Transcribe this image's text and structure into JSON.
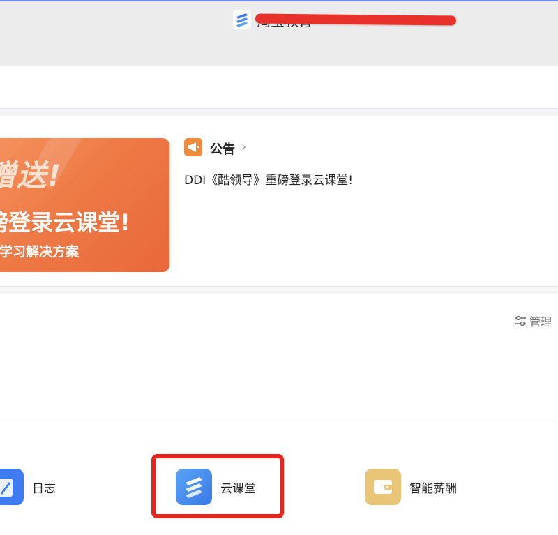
{
  "header": {
    "org_name": "淘宝教育"
  },
  "banner": {
    "line1": "赠送!",
    "line2": "磅登录云课堂!",
    "line3": "动学习解决方案"
  },
  "notice": {
    "title": "公告",
    "chevron": "›",
    "text": "DDI《酷领导》重磅登录云课堂!"
  },
  "apps_section": {
    "manage_label": "管理",
    "apps": [
      {
        "label": "日志",
        "icon": "log-icon"
      },
      {
        "label": "云课堂",
        "icon": "cloud-classroom-icon"
      },
      {
        "label": "智能薪酬",
        "icon": "wallet-icon"
      }
    ]
  },
  "colors": {
    "banner_orange": "#ee7a46",
    "highlight_red": "#e8241f",
    "notice_icon": "#f08a3c",
    "cloud_blue": "#3a79e8",
    "salary_gold": "#e8c577"
  }
}
